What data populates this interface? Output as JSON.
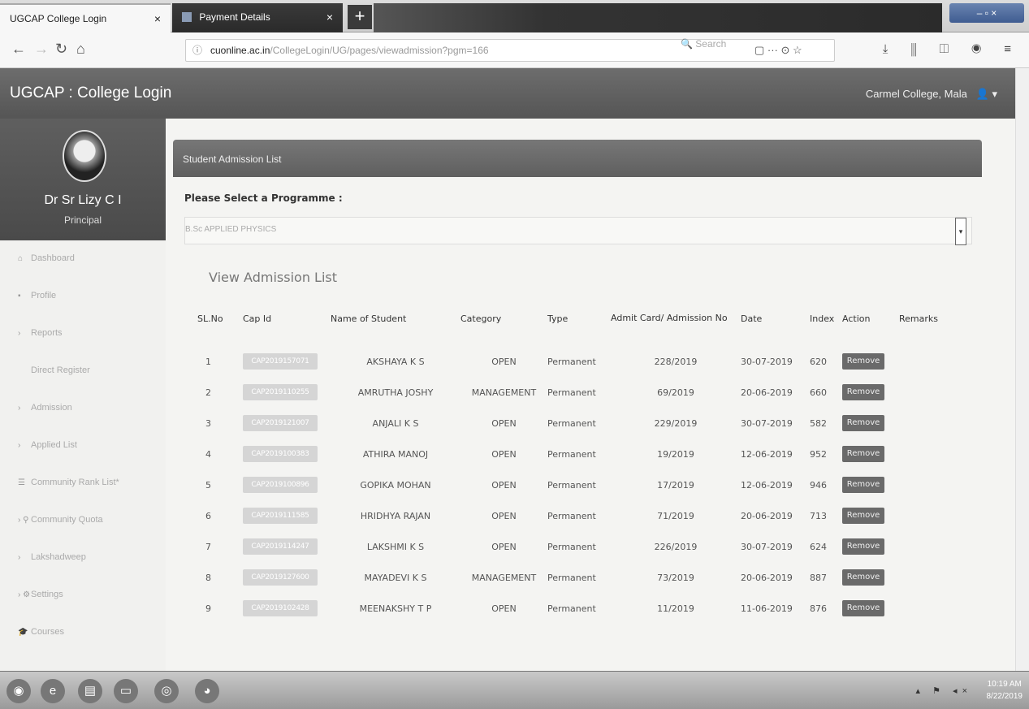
{
  "browser": {
    "tabs": [
      {
        "label": "UGCAP College Login",
        "close": "×"
      },
      {
        "label": "Payment Details",
        "close": "×"
      }
    ],
    "new_tab": "+",
    "window_controls": "– ▫ ×",
    "url_host": "cuonline.ac.in",
    "url_path": "/CollegeLogin/UG/pages/viewadmission?pgm=166",
    "url_actions": "▢   ···  ⊙  ☆",
    "search_placeholder": "🔍 Search",
    "toolbar_icons": "⤓ ⫼ ◫ ◉ ≡"
  },
  "header": {
    "app_title": "UGCAP : College Login",
    "college_name": "Carmel College, Mala",
    "user_icon": "👤 ▾"
  },
  "sidebar": {
    "name": "Dr Sr Lizy C I",
    "role": "Principal",
    "items": [
      {
        "icon": "home-icon",
        "glyph": "⌂",
        "label": "Dashboard"
      },
      {
        "icon": "user-icon",
        "glyph": "▪",
        "label": "Profile"
      },
      {
        "icon": "arrow-icon",
        "glyph": "›",
        "label": "Reports"
      },
      {
        "icon": "none",
        "glyph": "",
        "label": "Direct Register"
      },
      {
        "icon": "arrow-icon",
        "glyph": "›",
        "label": "Admission"
      },
      {
        "icon": "arrow-icon",
        "glyph": "›",
        "label": "Applied List"
      },
      {
        "icon": "list-icon",
        "glyph": "☰",
        "label": "Community Rank List*"
      },
      {
        "icon": "search-icon",
        "glyph": "› ⚲",
        "label": "Community Quota"
      },
      {
        "icon": "arrow-icon",
        "glyph": "›",
        "label": "Lakshadweep"
      },
      {
        "icon": "gear-icon",
        "glyph": "› ⚙",
        "label": "Settings"
      },
      {
        "icon": "cap-icon",
        "glyph": "🎓",
        "label": "Courses"
      }
    ]
  },
  "main": {
    "panel_title": "Student Admission List",
    "programme_label": "Please Select a Programme :",
    "programme_value": "B.Sc APPLIED PHYSICS",
    "select_caret": "▾",
    "view_title": "View Admission List",
    "columns": [
      "SL.No",
      "Cap Id",
      "Name of Student",
      "Category",
      "Type",
      "Admit Card/ Admission No",
      "Date",
      "Index",
      "Action",
      "Remarks"
    ],
    "remove_label": "Remove",
    "rows": [
      {
        "sl": "1",
        "cap": "CAP2019157071",
        "name": "AKSHAYA K S",
        "category": "OPEN",
        "type": "Permanent",
        "adm": "228/2019",
        "date": "30-07-2019",
        "index": "620"
      },
      {
        "sl": "2",
        "cap": "CAP2019110255",
        "name": "AMRUTHA JOSHY",
        "category": "MANAGEMENT",
        "type": "Permanent",
        "adm": "69/2019",
        "date": "20-06-2019",
        "index": "660"
      },
      {
        "sl": "3",
        "cap": "CAP2019121007",
        "name": "ANJALI K S",
        "category": "OPEN",
        "type": "Permanent",
        "adm": "229/2019",
        "date": "30-07-2019",
        "index": "582"
      },
      {
        "sl": "4",
        "cap": "CAP2019100383",
        "name": "ATHIRA MANOJ",
        "category": "OPEN",
        "type": "Permanent",
        "adm": "19/2019",
        "date": "12-06-2019",
        "index": "952"
      },
      {
        "sl": "5",
        "cap": "CAP2019100896",
        "name": "GOPIKA MOHAN",
        "category": "OPEN",
        "type": "Permanent",
        "adm": "17/2019",
        "date": "12-06-2019",
        "index": "946"
      },
      {
        "sl": "6",
        "cap": "CAP2019111585",
        "name": "HRIDHYA RAJAN",
        "category": "OPEN",
        "type": "Permanent",
        "adm": "71/2019",
        "date": "20-06-2019",
        "index": "713"
      },
      {
        "sl": "7",
        "cap": "CAP2019114247",
        "name": "LAKSHMI K S",
        "category": "OPEN",
        "type": "Permanent",
        "adm": "226/2019",
        "date": "30-07-2019",
        "index": "624"
      },
      {
        "sl": "8",
        "cap": "CAP2019127600",
        "name": "MAYADEVI K S",
        "category": "MANAGEMENT",
        "type": "Permanent",
        "adm": "73/2019",
        "date": "20-06-2019",
        "index": "887"
      },
      {
        "sl": "9",
        "cap": "CAP2019102428",
        "name": "MEENAKSHY T P",
        "category": "OPEN",
        "type": "Permanent",
        "adm": "11/2019",
        "date": "11-06-2019",
        "index": "876"
      }
    ]
  },
  "taskbar": {
    "icons": [
      {
        "name": "start-orb-icon",
        "glyph": "◉"
      },
      {
        "name": "ie-icon",
        "glyph": "e"
      },
      {
        "name": "explorer-icon",
        "glyph": "▤"
      },
      {
        "name": "folder-icon",
        "glyph": "▭"
      },
      {
        "name": "chrome-icon",
        "glyph": "◎"
      },
      {
        "name": "firefox-icon",
        "glyph": "◕"
      }
    ],
    "tray": "▴ ⚑ ◂×",
    "time": "10:19 AM",
    "date": "8/22/2019"
  }
}
